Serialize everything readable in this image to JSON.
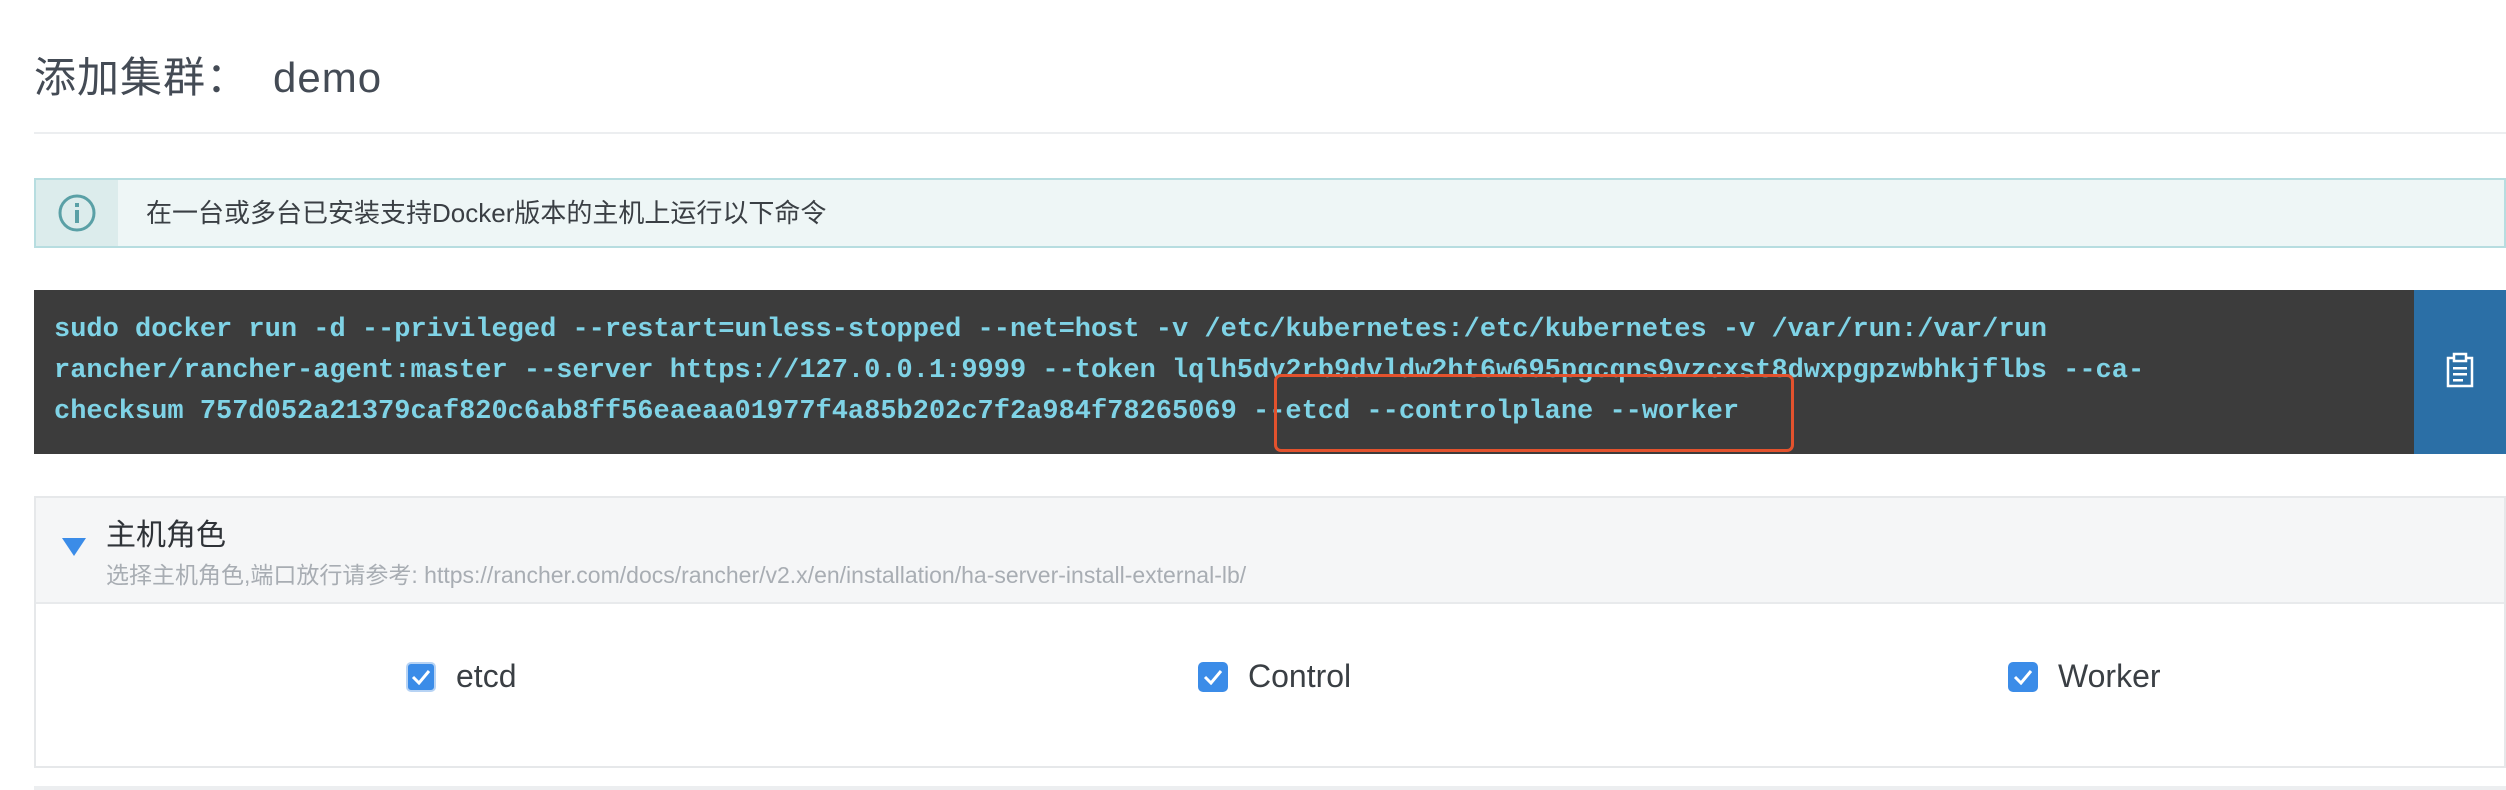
{
  "page": {
    "title_prefix": "添加集群：",
    "cluster_name": "demo"
  },
  "info": {
    "icon": "info-circle-icon",
    "message": "在一台或多台已安装支持Docker版本的主机上运行以下命令"
  },
  "command": {
    "lines": [
      "sudo docker run -d --privileged --restart=unless-stopped --net=host -v /etc/kubernetes:/etc/kubernetes -v /var/run:/var/run",
      "rancher/rancher-agent:master --server https://127.0.0.1:9999 --token lqlh5dv2rb9dvldw2ht6w695pgcqns9vzcxst8dwxpgpzwbhkjflbs --ca-",
      "checksum 757d052a21379caf820c6ab8ff56eaeaa01977f4a85b202c7f2a984f78265069 --etcd --controlplane --worker"
    ],
    "copy_icon": "clipboard-icon",
    "highlighted_flags": "--etcd --controlplane --worker"
  },
  "roles": {
    "heading": "主机角色",
    "subtext": "选择主机角色,端口放行请参考: https://rancher.com/docs/rancher/v2.x/en/installation/ha-server-install-external-lb/",
    "options": [
      {
        "label": "etcd",
        "checked": true
      },
      {
        "label": "Control",
        "checked": true
      },
      {
        "label": "Worker",
        "checked": true
      }
    ]
  },
  "colors": {
    "accent_blue": "#3b8ce8",
    "copy_button": "#2b6fa6",
    "command_bg": "#3c3c3c",
    "command_text": "#7fd3e6",
    "highlight": "#e3522d"
  }
}
